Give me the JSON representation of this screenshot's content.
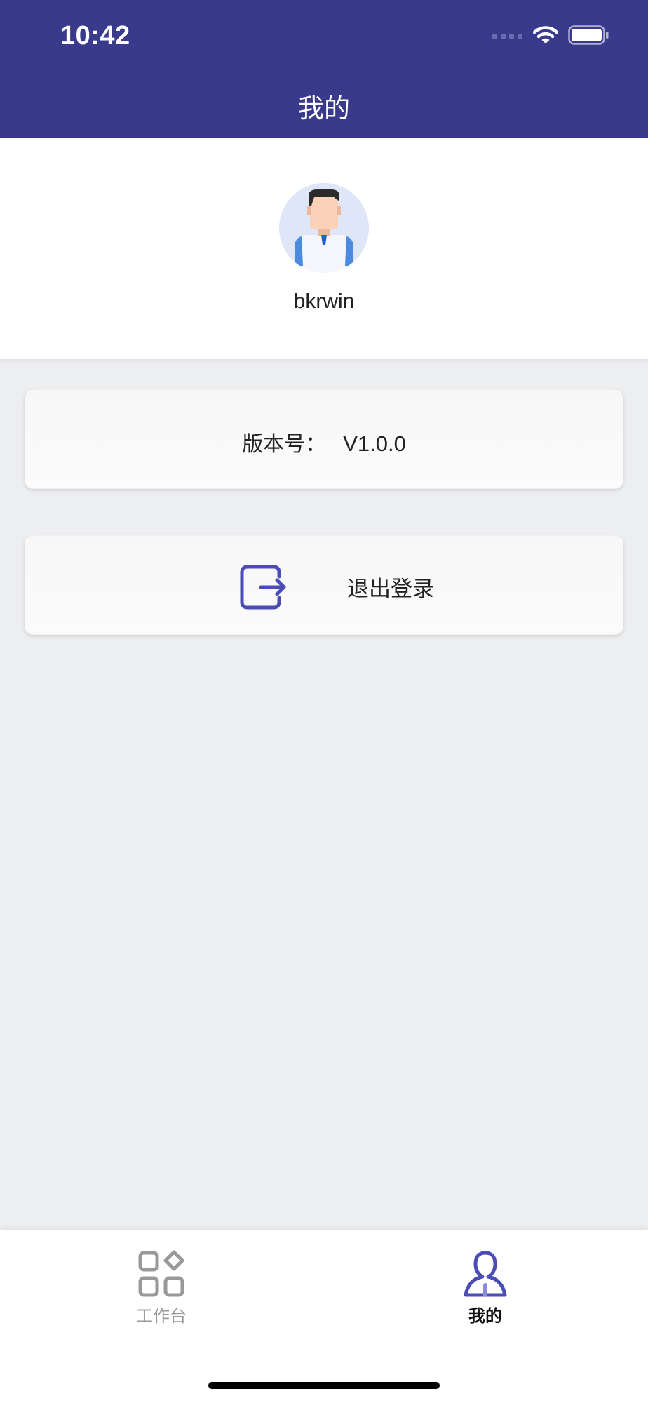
{
  "status_bar": {
    "time": "10:42",
    "icons": [
      "signal-icon",
      "wifi-icon",
      "battery-icon"
    ]
  },
  "header": {
    "title": "我的"
  },
  "profile": {
    "username": "bkrwin",
    "avatar": "user-avatar"
  },
  "version_card": {
    "label": "版本号：",
    "value": "V1.0.0"
  },
  "logout_card": {
    "label": "退出登录",
    "icon": "logout-icon"
  },
  "tabbar": {
    "tabs": [
      {
        "label": "工作台",
        "icon": "grid-icon",
        "active": false
      },
      {
        "label": "我的",
        "icon": "user-icon",
        "active": true
      }
    ]
  },
  "colors": {
    "primary": "#3a3a8c",
    "accent": "#4c4cb8",
    "background": "#edeef0",
    "tab_inactive": "#999999"
  }
}
